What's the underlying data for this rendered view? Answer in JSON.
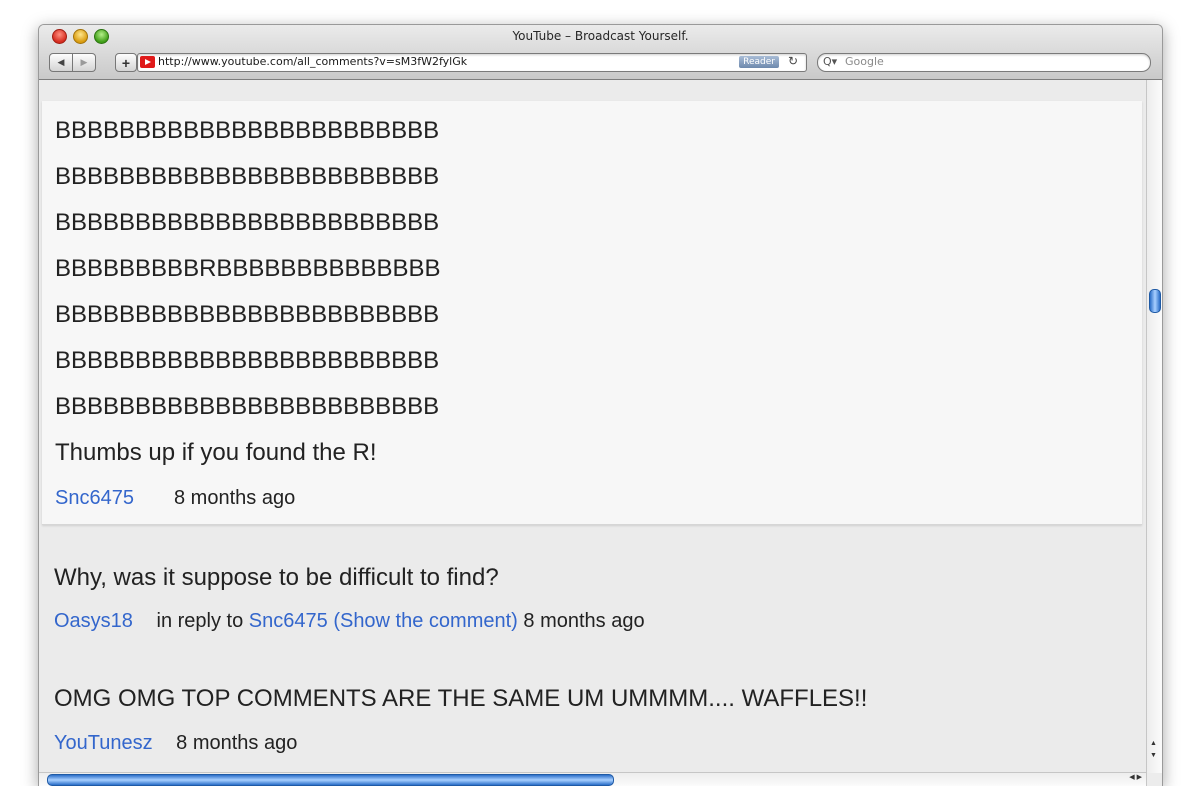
{
  "window": {
    "title": "YouTube – Broadcast Yourself."
  },
  "toolbar": {
    "back_glyph": "◀",
    "forward_glyph": "▶",
    "add_bookmark_glyph": "+",
    "url": "http://www.youtube.com/all_comments?v=sM3fW2fylGk",
    "reader_label": "Reader",
    "reload_glyph": "↻",
    "search_glyph": "Q▾",
    "search_placeholder": "Google"
  },
  "comments": {
    "top": {
      "lines": [
        "BBBBBBBBBBBBBBBBBBBBBBBB",
        "BBBBBBBBBBBBBBBBBBBBBBBB",
        "BBBBBBBBBBBBBBBBBBBBBBBB",
        "BBBBBBBBBRBBBBBBBBBBBBBB",
        "BBBBBBBBBBBBBBBBBBBBBBBB",
        "BBBBBBBBBBBBBBBBBBBBBBBB",
        "BBBBBBBBBBBBBBBBBBBBBBBB",
        "Thumbs up if you found the R!"
      ],
      "author": "Snc6475",
      "time": "8 months ago"
    },
    "reply1": {
      "text": "Why, was it suppose to be difficult to find?",
      "author": "Oasys18",
      "in_reply_to": "in reply to",
      "reply_target": "Snc6475",
      "show_comment": "(Show the comment)",
      "time": "8 months ago"
    },
    "reply2": {
      "text": "OMG OMG TOP COMMENTS ARE THE SAME UM UMMMM.... WAFFLES!!",
      "author": "YouTunesz",
      "time": "8 months ago"
    }
  },
  "scrollbars": {
    "up_glyph": "▲",
    "down_glyph": "▼",
    "left_glyph": "◀",
    "right_glyph": "▶"
  }
}
